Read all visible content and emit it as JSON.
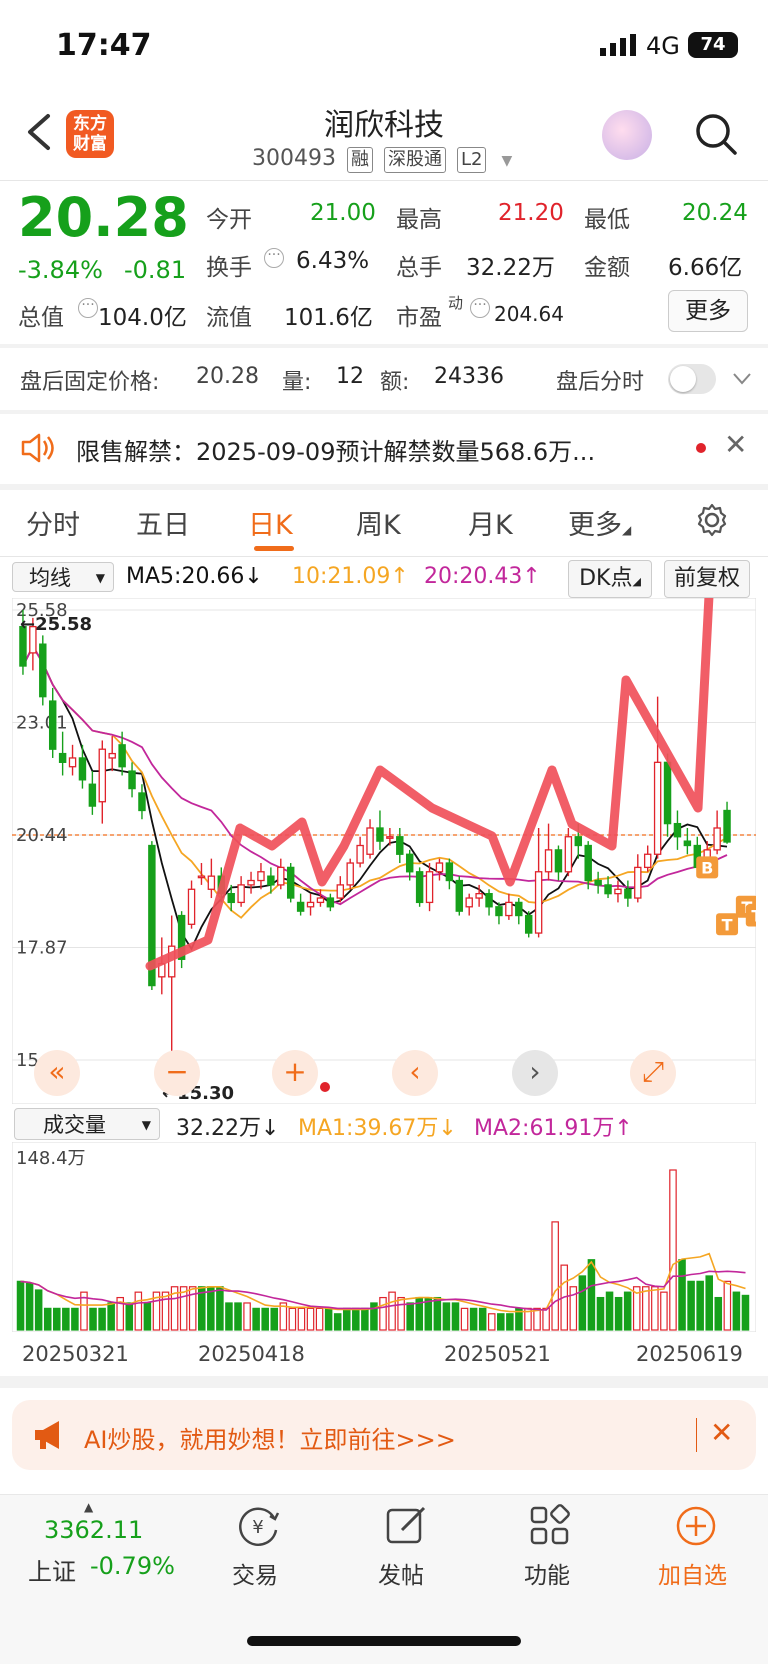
{
  "status_bar": {
    "time": "17:47",
    "network": "4G",
    "battery": "74"
  },
  "header": {
    "logo_line1": "东方",
    "logo_line2": "财富",
    "title": "润欣科技",
    "code": "300493",
    "tags": [
      "融",
      "深股通",
      "L2"
    ]
  },
  "quote": {
    "price": "20.28",
    "change_pct": "-3.84%",
    "change": "-0.81",
    "open_label": "今开",
    "open": "21.00",
    "high_label": "最高",
    "high": "21.20",
    "low_label": "最低",
    "low": "20.24",
    "turnover_label": "换手",
    "turnover": "6.43%",
    "volume_label": "总手",
    "volume": "32.22万",
    "amount_label": "金额",
    "amount": "6.66亿",
    "mktcap_label": "总值",
    "mktcap": "104.0亿",
    "float_label": "流值",
    "float": "101.6亿",
    "pe_label": "市盈",
    "pe_sup": "动",
    "pe": "204.64",
    "more_label": "更多"
  },
  "after_hours": {
    "price_label": "盘后固定价格:",
    "price": "20.28",
    "vol_label": "量:",
    "vol": "12",
    "amt_label": "额:",
    "amt": "24336",
    "timeshare_label": "盘后分时"
  },
  "notice": {
    "text": "限售解禁：2025-09-09预计解禁数量568.6万..."
  },
  "tabs": [
    "分时",
    "五日",
    "日K",
    "周K",
    "月K",
    "更多"
  ],
  "ma_bar": {
    "select": "均线",
    "ma5": "MA5:20.66↓",
    "ma10": "10:21.09↑",
    "ma20": "20:20.43↑",
    "dk": "DK点",
    "fq": "前复权"
  },
  "chart_data": {
    "type": "candlestick",
    "y_ticks": [
      "25.58",
      "23.01",
      "20.44",
      "17.87",
      "15.30"
    ],
    "ylim": [
      15.3,
      25.58
    ],
    "max_label": "←25.58",
    "min_label": "←15.30",
    "ref_line": 20.44,
    "candles": [
      [
        25.2,
        24.3,
        25.58,
        24.1
      ],
      [
        24.6,
        25.2,
        25.4,
        24.2
      ],
      [
        24.8,
        23.6,
        25.0,
        23.4
      ],
      [
        23.5,
        22.4,
        23.8,
        22.2
      ],
      [
        22.3,
        22.1,
        22.8,
        21.8
      ],
      [
        22.0,
        22.2,
        22.5,
        21.8
      ],
      [
        22.2,
        21.7,
        22.5,
        21.5
      ],
      [
        21.6,
        21.1,
        21.9,
        20.9
      ],
      [
        21.2,
        22.4,
        22.6,
        20.7
      ],
      [
        22.2,
        22.3,
        22.7,
        21.9
      ],
      [
        22.5,
        22.0,
        22.8,
        21.8
      ],
      [
        21.9,
        21.5,
        22.1,
        21.3
      ],
      [
        21.4,
        21.0,
        21.6,
        20.8
      ],
      [
        20.2,
        17.0,
        20.3,
        16.9
      ],
      [
        17.2,
        17.5,
        18.1,
        16.8
      ],
      [
        17.2,
        17.9,
        18.6,
        15.3
      ],
      [
        18.6,
        17.6,
        18.7,
        17.4
      ],
      [
        18.4,
        19.2,
        19.4,
        18.3
      ],
      [
        19.5,
        19.5,
        19.8,
        19.3
      ],
      [
        19.2,
        19.5,
        19.9,
        19.0
      ],
      [
        19.5,
        19.1,
        19.7,
        18.9
      ],
      [
        19.1,
        18.9,
        19.3,
        18.7
      ],
      [
        18.9,
        19.3,
        19.5,
        18.8
      ],
      [
        19.3,
        19.4,
        19.6,
        19.1
      ],
      [
        19.4,
        19.6,
        19.8,
        19.2
      ],
      [
        19.5,
        19.3,
        19.7,
        19.1
      ],
      [
        19.3,
        19.7,
        19.9,
        19.2
      ],
      [
        19.7,
        19.0,
        19.8,
        18.9
      ],
      [
        18.9,
        18.7,
        19.1,
        18.6
      ],
      [
        18.8,
        18.9,
        19.1,
        18.6
      ],
      [
        18.9,
        19.0,
        19.2,
        18.8
      ],
      [
        19.0,
        18.8,
        19.1,
        18.7
      ],
      [
        19.0,
        19.3,
        19.5,
        18.9
      ],
      [
        19.3,
        19.8,
        19.9,
        19.2
      ],
      [
        19.8,
        20.2,
        20.4,
        19.7
      ],
      [
        20.0,
        20.6,
        20.8,
        19.9
      ],
      [
        20.6,
        20.3,
        21.0,
        20.1
      ],
      [
        20.4,
        20.4,
        20.6,
        20.2
      ],
      [
        20.4,
        20.0,
        20.6,
        19.8
      ],
      [
        20.0,
        19.6,
        20.1,
        19.4
      ],
      [
        19.6,
        18.9,
        19.7,
        18.8
      ],
      [
        18.9,
        19.6,
        19.8,
        18.7
      ],
      [
        19.6,
        19.8,
        19.9,
        19.4
      ],
      [
        19.8,
        19.4,
        19.9,
        19.2
      ],
      [
        19.4,
        18.7,
        19.5,
        18.6
      ],
      [
        18.8,
        19.0,
        19.1,
        18.6
      ],
      [
        19.0,
        19.1,
        19.3,
        18.8
      ],
      [
        19.1,
        18.8,
        19.2,
        18.6
      ],
      [
        18.8,
        18.6,
        18.9,
        18.4
      ],
      [
        18.6,
        18.9,
        19.1,
        18.5
      ],
      [
        18.9,
        18.6,
        19.0,
        18.4
      ],
      [
        18.6,
        18.2,
        18.7,
        18.1
      ],
      [
        18.2,
        19.6,
        20.6,
        18.1
      ],
      [
        19.6,
        20.1,
        20.7,
        19.4
      ],
      [
        20.1,
        19.6,
        20.2,
        19.4
      ],
      [
        19.6,
        20.4,
        20.6,
        19.5
      ],
      [
        20.4,
        20.2,
        20.7,
        19.9
      ],
      [
        20.2,
        19.4,
        20.3,
        19.2
      ],
      [
        19.4,
        19.3,
        19.6,
        19.1
      ],
      [
        19.3,
        19.1,
        19.5,
        19.0
      ],
      [
        19.1,
        19.2,
        19.4,
        18.9
      ],
      [
        19.2,
        19.0,
        19.4,
        18.8
      ],
      [
        19.0,
        19.7,
        20.0,
        18.9
      ],
      [
        19.7,
        20.0,
        20.2,
        19.6
      ],
      [
        20.0,
        22.1,
        23.6,
        19.9
      ],
      [
        22.1,
        20.7,
        22.3,
        20.4
      ],
      [
        20.7,
        20.4,
        21.0,
        20.1
      ],
      [
        20.3,
        20.2,
        20.6,
        20.0
      ],
      [
        20.2,
        19.7,
        20.4,
        19.5
      ],
      [
        19.7,
        20.1,
        20.3,
        19.6
      ],
      [
        20.1,
        20.6,
        21.0,
        20.0
      ],
      [
        21.0,
        20.28,
        21.2,
        20.24
      ]
    ],
    "signals": [
      {
        "label": "B",
        "index": 69,
        "price": 19.7
      },
      {
        "label": "T",
        "index": 71,
        "price": 18.4
      },
      {
        "label": "T",
        "index": 73,
        "price": 18.8
      },
      {
        "label": "T",
        "index": 74,
        "price": 18.6
      }
    ]
  },
  "chart_controls": [
    "«",
    "−",
    "+",
    "‹",
    "›",
    "⤢"
  ],
  "volume": {
    "select": "成交量",
    "value": "32.22万↓",
    "ma1": "MA1:39.67万↓",
    "ma2": "MA2:61.91万↑",
    "max_label": "148.4万",
    "dates": [
      "20250321",
      "20250418",
      "20250521",
      "20250619"
    ],
    "bars": [
      45,
      43,
      37,
      20,
      20,
      20,
      20,
      35,
      20,
      20,
      25,
      30,
      25,
      35,
      25,
      35,
      35,
      40,
      40,
      40,
      40,
      40,
      40,
      25,
      25,
      25,
      20,
      20,
      20,
      25,
      20,
      20,
      20,
      20,
      20,
      15,
      20,
      20,
      20,
      25,
      30,
      35,
      30,
      25,
      30,
      30,
      30,
      25,
      25,
      20,
      20,
      20,
      15,
      15,
      15,
      20,
      20,
      20,
      20,
      100,
      60,
      40,
      50,
      65,
      30,
      35,
      30,
      35,
      40,
      40,
      40,
      35,
      148,
      65,
      45,
      45,
      50,
      30,
      45,
      35,
      32
    ],
    "up_flags": [
      0,
      0,
      0,
      0,
      0,
      0,
      0,
      1,
      0,
      0,
      0,
      1,
      0,
      1,
      0,
      1,
      1,
      1,
      1,
      1,
      0,
      0,
      0,
      0,
      0,
      1,
      0,
      0,
      0,
      1,
      1,
      1,
      1,
      1,
      0,
      0,
      0,
      0,
      0,
      0,
      1,
      1,
      1,
      0,
      0,
      0,
      0,
      0,
      0,
      1,
      0,
      0,
      1,
      0,
      0,
      0,
      1,
      1,
      1,
      1,
      1,
      1,
      0,
      0,
      0,
      0,
      0,
      0,
      1,
      1,
      1,
      1,
      1,
      0,
      0,
      0,
      0,
      0,
      1,
      0,
      0
    ]
  },
  "ad": {
    "text": "AI炒股，就用妙想！立即前往>>>"
  },
  "bottom_nav": {
    "index_value": "3362.11",
    "index_name": "上证",
    "index_pct": "-0.79%",
    "items": [
      "交易",
      "发帖",
      "功能",
      "加自选"
    ]
  },
  "colors": {
    "up": "#e0232b",
    "down": "#16a01b",
    "accent": "#f06c1a",
    "ma5": "#111111",
    "ma10": "#f5a623",
    "ma20": "#c2279b",
    "annotation": "#f0505a"
  }
}
